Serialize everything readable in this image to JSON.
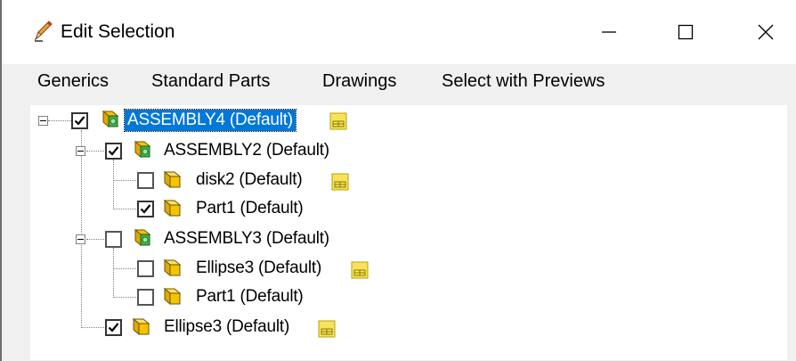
{
  "window": {
    "title": "Edit Selection",
    "minimize_glyph": "—",
    "maximize_glyph": "☐",
    "close_glyph": "✕"
  },
  "menu": {
    "items": [
      "Generics",
      "Standard Parts",
      "Drawings",
      "Select with Previews"
    ]
  },
  "tree": {
    "nodes": [
      {
        "label": "ASSEMBLY4 (Default)",
        "type": "assembly",
        "checked": true,
        "selected": true,
        "preview": true
      },
      {
        "label": "ASSEMBLY2 (Default)",
        "type": "assembly",
        "checked": true,
        "preview": false
      },
      {
        "label": "disk2 (Default)",
        "type": "part",
        "checked": false,
        "preview": true
      },
      {
        "label": "Part1 (Default)",
        "type": "part",
        "checked": true,
        "preview": false
      },
      {
        "label": "ASSEMBLY3 (Default)",
        "type": "assembly",
        "checked": false,
        "preview": false
      },
      {
        "label": "Ellipse3 (Default)",
        "type": "part",
        "checked": false,
        "preview": true
      },
      {
        "label": "Part1 (Default)",
        "type": "part",
        "checked": false,
        "preview": false
      },
      {
        "label": "Ellipse3 (Default)",
        "type": "part",
        "checked": true,
        "preview": true
      }
    ]
  },
  "icons": {
    "title": "pencil-icon",
    "assembly": "assembly-icon",
    "part": "part-icon",
    "preview": "preview-available-icon"
  },
  "colors": {
    "selection": "#0078d7",
    "part_yellow": "#f5c400",
    "assembly_green": "#3bb54a"
  }
}
